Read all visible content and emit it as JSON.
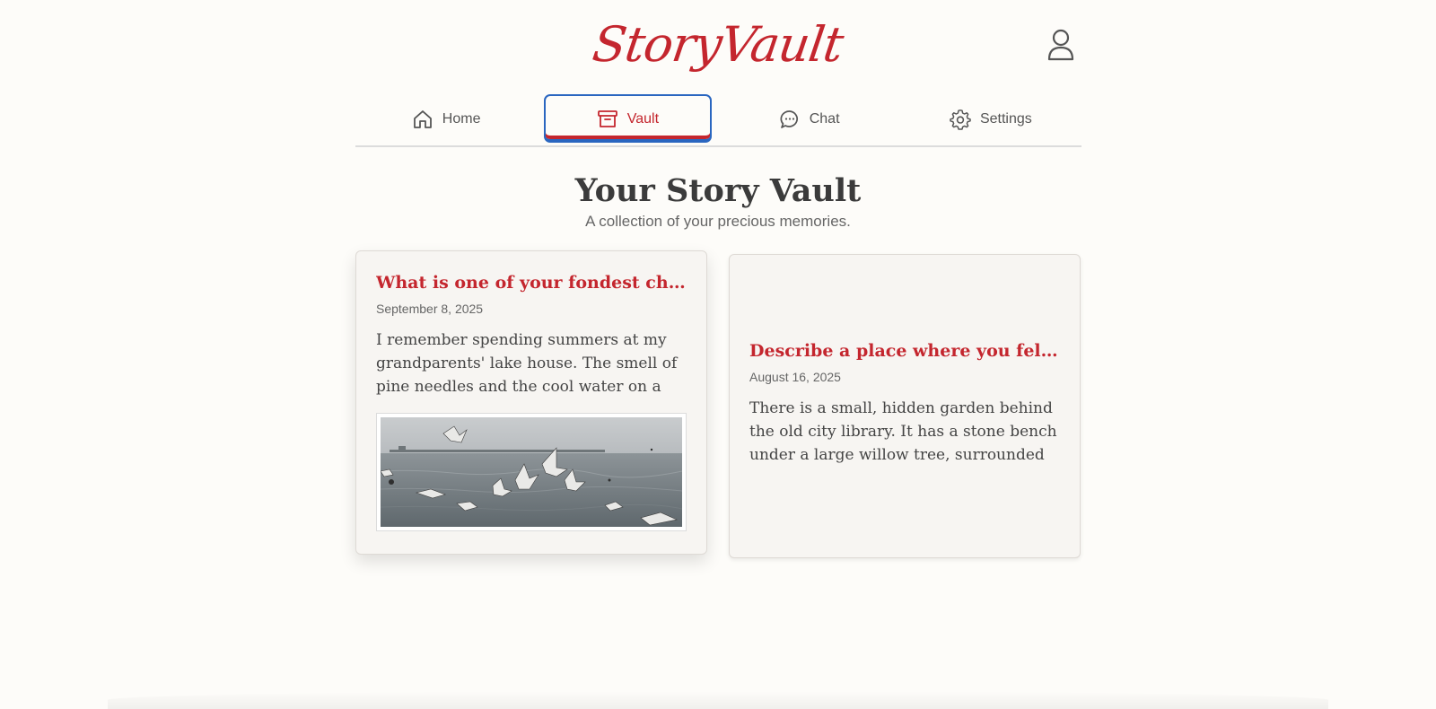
{
  "header": {
    "logo": "StoryVault",
    "profile_icon": "user-icon"
  },
  "nav": {
    "tabs": [
      {
        "label": "Home",
        "icon": "home-icon",
        "active": false
      },
      {
        "label": "Vault",
        "icon": "archive-box-icon",
        "active": true
      },
      {
        "label": "Chat",
        "icon": "chat-bubble-icon",
        "active": false
      },
      {
        "label": "Settings",
        "icon": "gear-icon",
        "active": false
      }
    ]
  },
  "main": {
    "title": "Your Story Vault",
    "subtitle": "A collection of your precious memories."
  },
  "stories": [
    {
      "title": "What is one of your fondest childho...",
      "date": "September 8, 2025",
      "excerpt": "I remember spending summers at my grandparents' lake house. The smell of pine needles and the cool water on a hot day...",
      "has_photo": true
    },
    {
      "title": "Describe a place where you felt perf...",
      "date": "August 16, 2025",
      "excerpt": "There is a small, hidden garden behind the old city library. It has a stone bench under a large willow tree, surrounded by lavend...",
      "has_photo": false
    }
  ],
  "colors": {
    "brand": "#c4262e",
    "focus_ring": "#2a66c0",
    "background": "#fdfcf9",
    "card": "#f7f5f2"
  }
}
